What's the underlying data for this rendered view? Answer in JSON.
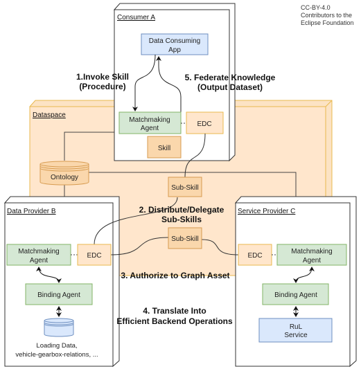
{
  "license": [
    "CC-BY-4.0",
    "Contributors to the",
    "Eclipse Foundation"
  ],
  "dataspace": {
    "title": "Dataspace"
  },
  "consumer": {
    "title": "Consumer A",
    "app": [
      "Data Consuming",
      "App"
    ],
    "matchmaking": [
      "Matchmaking",
      "Agent"
    ],
    "edc": "EDC",
    "skill": "Skill"
  },
  "ontology": "Ontology",
  "subskills": [
    "Sub-Skill",
    "Sub-Skill"
  ],
  "provider_b": {
    "title": "Data Provider B",
    "matchmaking": [
      "Matchmaking",
      "Agent"
    ],
    "edc": "EDC",
    "binding": "Binding Agent",
    "data": [
      "Loading Data,",
      "vehicle-gearbox-relations, ..."
    ]
  },
  "provider_c": {
    "title": "Service Provider C",
    "matchmaking": [
      "Matchmaking",
      "Agent"
    ],
    "edc": "EDC",
    "binding": "Binding Agent",
    "service": [
      "RuL",
      "Service"
    ]
  },
  "steps": {
    "s1": [
      "1.Invoke Skill",
      "(Procedure)"
    ],
    "s2": [
      "2. Distribute/Delegate",
      "Sub-Skills"
    ],
    "s3": "3. Authorize to Graph Asset",
    "s4": [
      "4. Translate Into",
      "Efficient Backend Operations"
    ],
    "s5": [
      "5. Federate Knowledge",
      "(Output Dataset)"
    ]
  },
  "colors": {
    "dataspace": "#ffe6cc",
    "agent": "#d5e8d4",
    "app": "#dae8fc",
    "edc": "#ffe6cc",
    "skill": "#fad7ac"
  }
}
